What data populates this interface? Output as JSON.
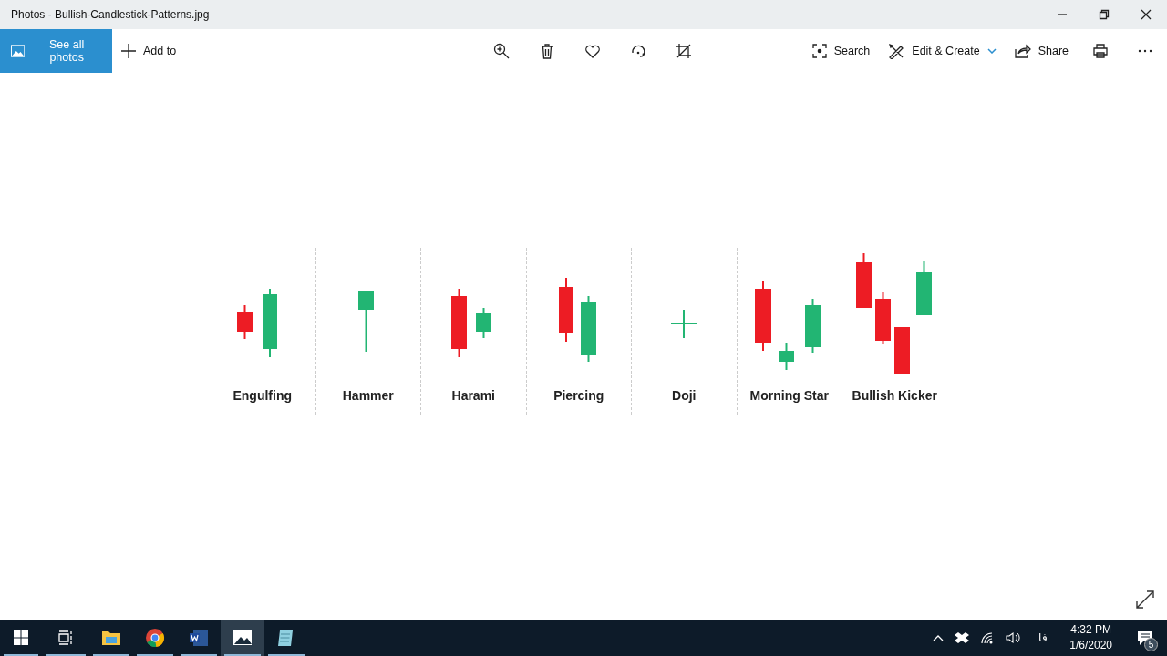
{
  "window": {
    "title": "Photos - Bullish-Candlestick-Patterns.jpg"
  },
  "toolbar": {
    "see_all": "See all photos",
    "add_to": "Add to",
    "search": "Search",
    "edit_create": "Edit & Create",
    "share": "Share"
  },
  "image": {
    "patterns": [
      {
        "label": "Engulfing"
      },
      {
        "label": "Hammer"
      },
      {
        "label": "Harami"
      },
      {
        "label": "Piercing"
      },
      {
        "label": "Doji"
      },
      {
        "label": "Morning Star"
      },
      {
        "label": "Bullish Kicker"
      }
    ]
  },
  "taskbar": {
    "apps": [
      {
        "kind": "folder",
        "selected": false
      },
      {
        "kind": "browser",
        "selected": false
      },
      {
        "kind": "word",
        "selected": false
      },
      {
        "kind": "photos",
        "selected": true
      },
      {
        "kind": "notepad",
        "selected": false
      }
    ],
    "language": "فا",
    "time": "4:32 PM",
    "date": "1/6/2020",
    "notifications": "5"
  }
}
